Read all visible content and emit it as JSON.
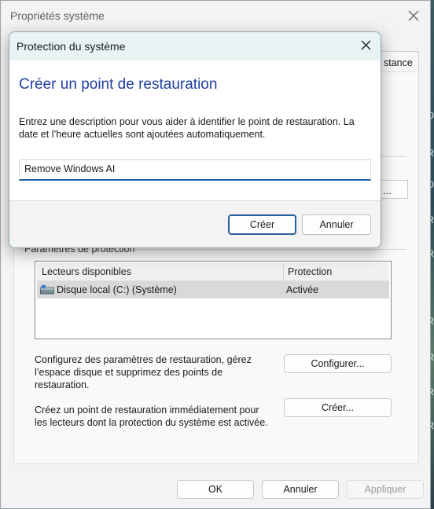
{
  "main_window": {
    "title": "Propriétés système",
    "tab_peek_label": "stance",
    "protection_group_label": "Paramètres de protection",
    "drives": {
      "headers": [
        "Lecteurs disponibles",
        "Protection"
      ],
      "rows": [
        {
          "name": "Disque local (C:) (Système)",
          "protection": "Activée"
        }
      ]
    },
    "configure_desc": "Configurez des paramètres de restauration, gérez l’espace disque et supprimez des points de restauration.",
    "configure_button": "Configurer...",
    "create_desc": "Créez un point de restauration immédiatement pour les lecteurs dont la protection du système est activée.",
    "create_button": "Créer...",
    "footer": {
      "ok": "OK",
      "cancel": "Annuler",
      "apply": "Appliquer"
    }
  },
  "dialog": {
    "title": "Protection du système",
    "heading": "Créer un point de restauration",
    "description": "Entrez une description pour vous aider à identifier le point de restauration. La date et l’heure actuelles sont ajoutées automatiquement.",
    "input_value": "Remove Windows AI",
    "create_button": "Créer",
    "cancel_button": "Annuler"
  },
  "background_letters": [
    "D",
    "R",
    "D",
    "R",
    "R",
    "R",
    "R",
    "R",
    "R"
  ],
  "colors": {
    "accent": "#1f3fa0",
    "title_bar": "#e8f4f3",
    "input_underline": "#1c5fa8"
  }
}
